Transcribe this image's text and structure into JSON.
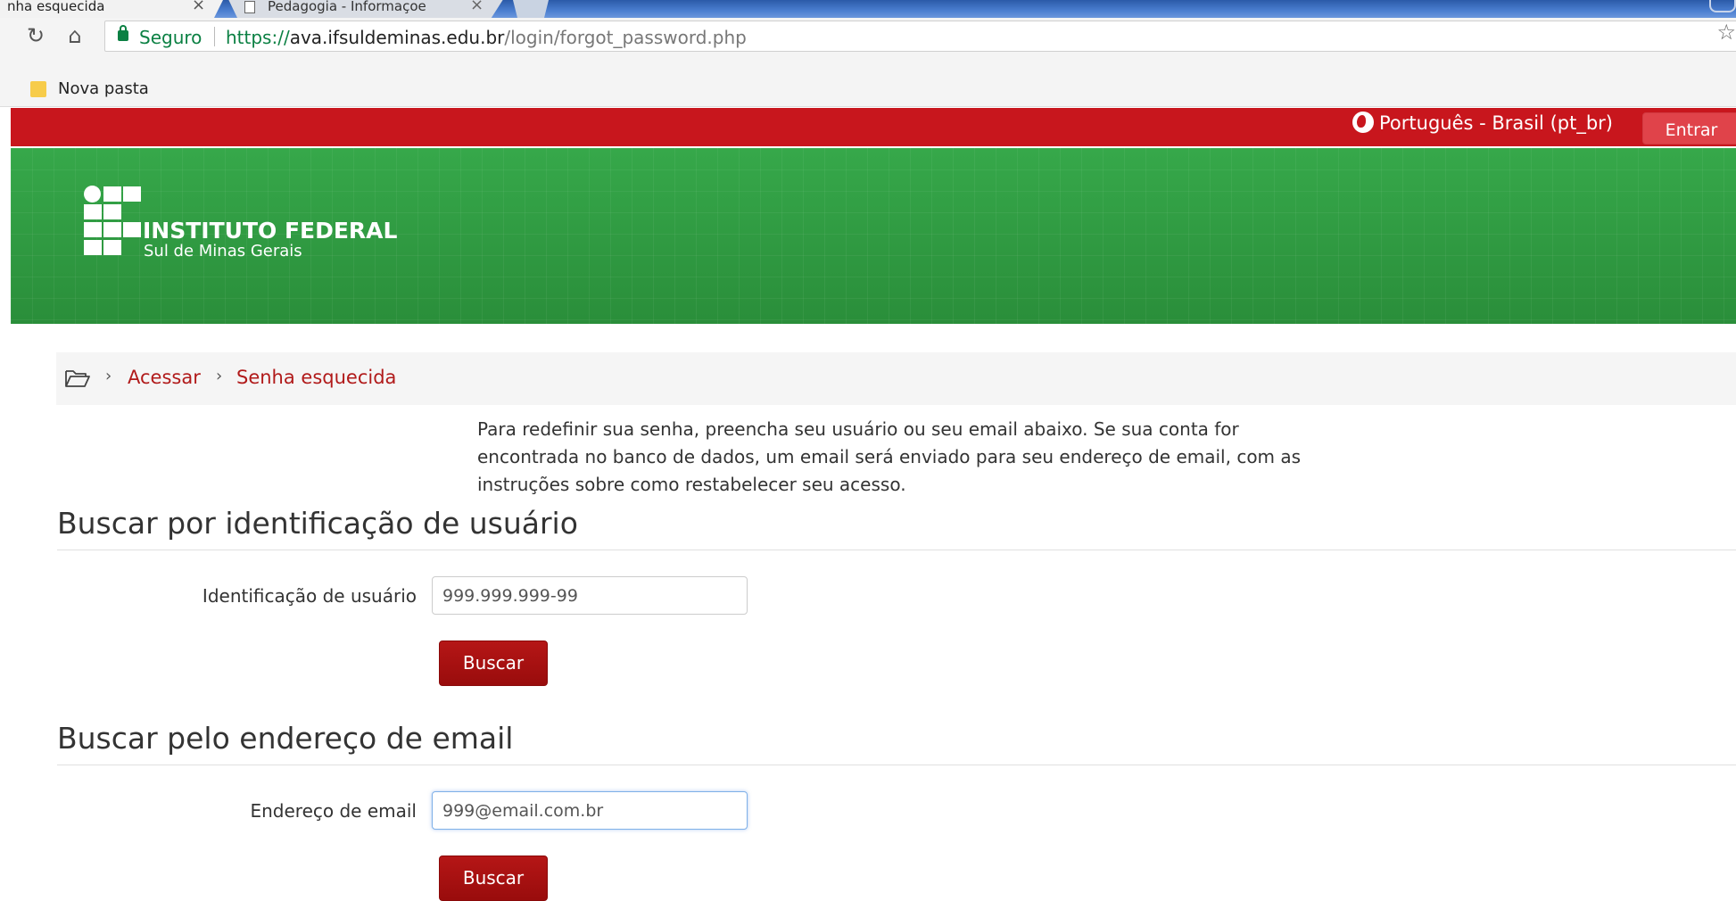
{
  "browser": {
    "tabs": [
      {
        "label": "nha esquecida"
      },
      {
        "label": "Pedagogia - Informaçoe"
      }
    ],
    "secure_label": "Seguro",
    "url": {
      "scheme": "https://",
      "host": "ava.ifsuldeminas.edu.br",
      "path": "/login/forgot_password.php"
    },
    "bookmarks": [
      {
        "label": "Nova pasta"
      }
    ]
  },
  "navbar": {
    "language": "Português - Brasil (pt_br)",
    "login_label": "Entrar"
  },
  "header": {
    "logo_title": "INSTITUTO FEDERAL",
    "logo_subtitle": "Sul de Minas Gerais"
  },
  "breadcrumb": {
    "items": [
      "Acessar",
      "Senha esquecida"
    ]
  },
  "main": {
    "intro": "Para redefinir sua senha, preencha seu usuário ou seu email abaixo. Se sua conta for encontrada no banco de dados, um email será enviado para seu endereço de email, com as instruções sobre como restabelecer seu acesso.",
    "username_section": {
      "title": "Buscar por identificação de usuário",
      "field_label": "Identificação de usuário",
      "field_value": "999.999.999-99",
      "button_label": "Buscar"
    },
    "email_section": {
      "title": "Buscar pelo endereço de email",
      "field_label": "Endereço de email",
      "field_value": "999@email.com.br",
      "button_label": "Buscar"
    }
  },
  "colors": {
    "navbar_red": "#c8161d",
    "header_green": "#2e9a3f",
    "button_red": "#a81010",
    "link_red": "#b11a1a",
    "secure_green": "#0b8043"
  }
}
